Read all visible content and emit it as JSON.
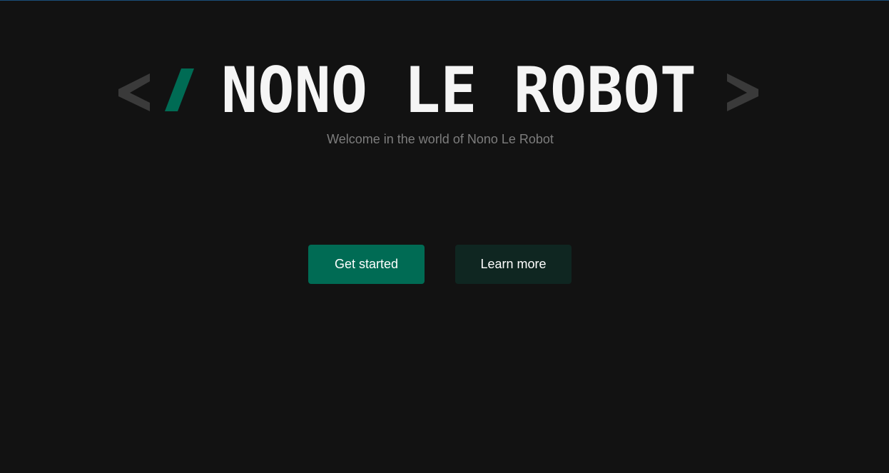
{
  "hero": {
    "open_bracket": "<",
    "slash": "/",
    "title": "NONO LE ROBOT",
    "close_bracket": ">",
    "subtitle": "Welcome in the world of Nono Le Robot"
  },
  "actions": {
    "primary_label": "Get started",
    "secondary_label": "Learn more"
  },
  "colors": {
    "background": "#121212",
    "title": "#f5f5f5",
    "bracket": "#3a3a3a",
    "accent": "#006b54",
    "secondary_button": "#0f2621",
    "subtitle": "#7d7d7d"
  }
}
